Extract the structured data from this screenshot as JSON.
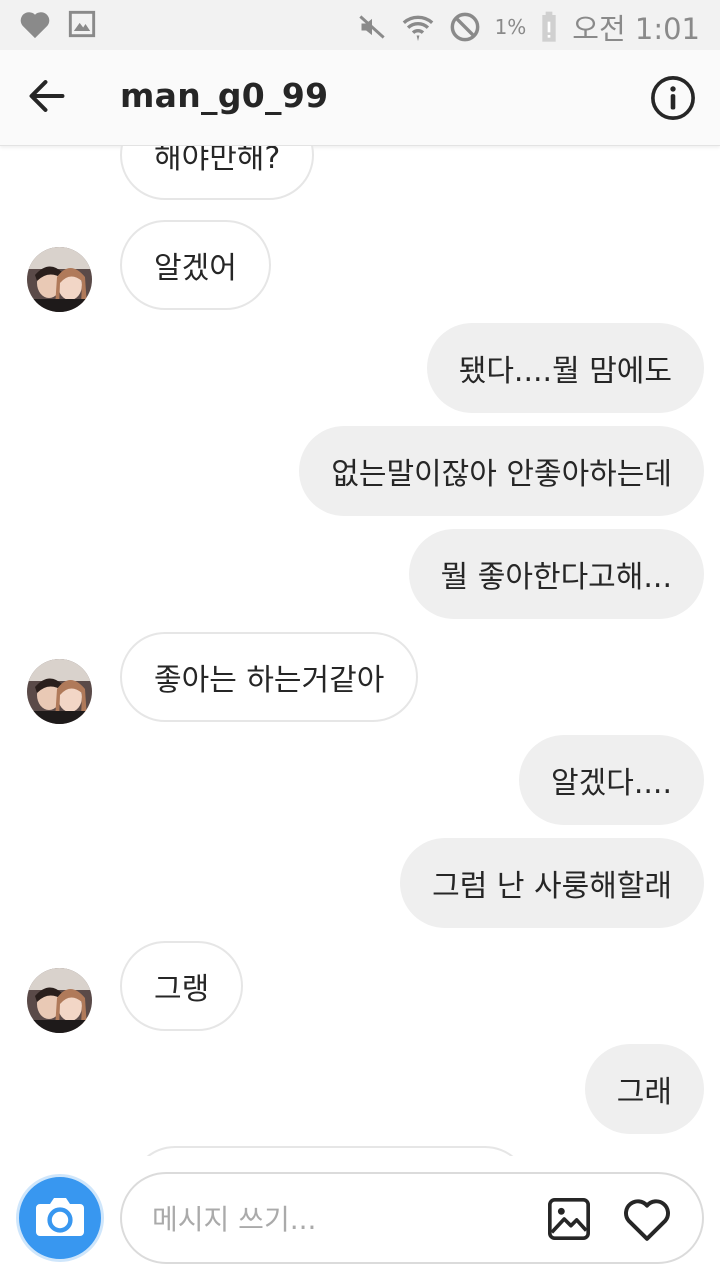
{
  "status_bar": {
    "battery_percent": "1%",
    "time": "오전 1:01"
  },
  "header": {
    "username": "man_g0_99"
  },
  "messages": [
    {
      "side": "in",
      "text": "해야만해?"
    },
    {
      "side": "in",
      "text": "알겠어"
    },
    {
      "side": "out",
      "text": "됐다....뭘 맘에도"
    },
    {
      "side": "out",
      "text": "없는말이잖아 안좋아하는데"
    },
    {
      "side": "out",
      "text": "뭘 좋아한다고해..."
    },
    {
      "side": "in",
      "text": "좋아는 하는거같아"
    },
    {
      "side": "out",
      "text": "알겠다...."
    },
    {
      "side": "out",
      "text": "그럼 난 사룽해할래"
    },
    {
      "side": "in",
      "text": "그랭"
    },
    {
      "side": "out",
      "text": "그래"
    }
  ],
  "composer": {
    "placeholder": "메시지 쓰기..."
  },
  "colors": {
    "accent_blue": "#3897f0",
    "incoming_bubble": "#ffffff",
    "outgoing_bubble": "#efefef",
    "text": "#262626"
  },
  "icons": {
    "status_left": [
      "heart-icon",
      "image-icon"
    ],
    "status_right": [
      "mute-icon",
      "wifi-icon",
      "do-not-disturb-icon",
      "battery-icon"
    ],
    "header": [
      "back-arrow-icon",
      "info-icon"
    ],
    "composer": [
      "camera-icon",
      "gallery-icon",
      "heart-icon"
    ]
  }
}
